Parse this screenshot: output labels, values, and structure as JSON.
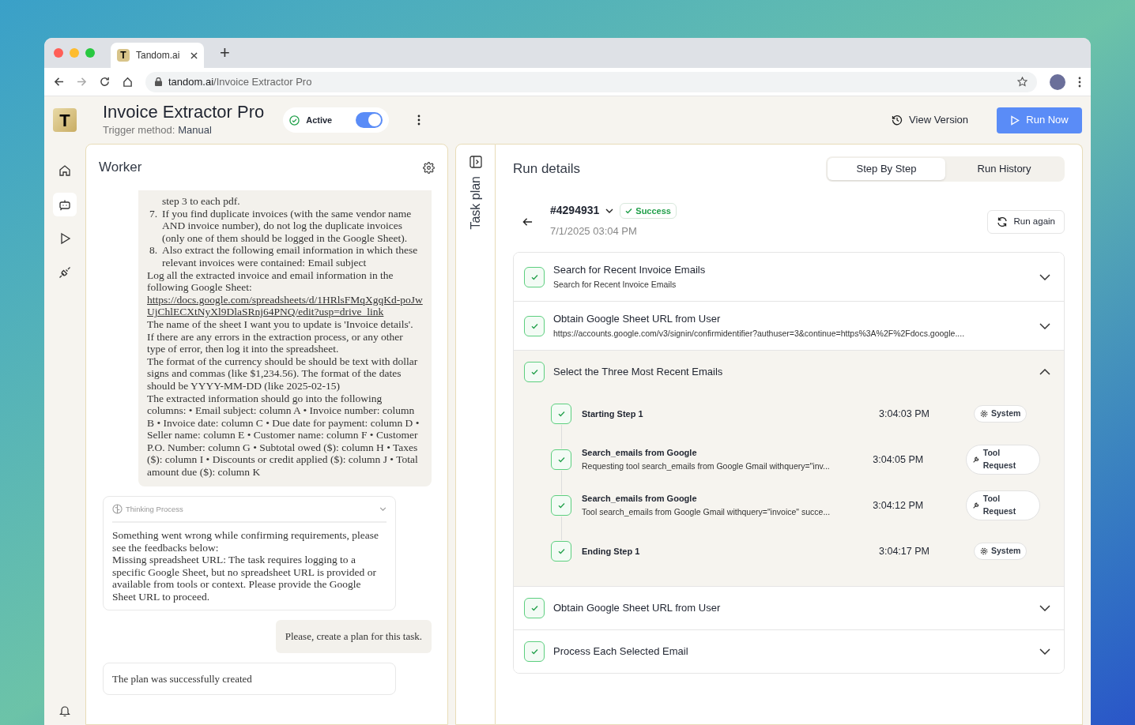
{
  "browser": {
    "tab_title": "Tandom.ai",
    "tab_logo": "T",
    "new_tab": "+",
    "url_host": "tandom.ai",
    "url_path": "/Invoice Extractor Pro"
  },
  "header": {
    "logo": "T",
    "title": "Invoice Extractor Pro",
    "trigger_label": "Trigger method:",
    "trigger_value": "Manual",
    "status": {
      "label": "Active",
      "on": true
    },
    "view_version": "View Version",
    "run_now": "Run Now"
  },
  "sidebar": {
    "items": [
      {
        "selected": false
      },
      {
        "selected": true
      },
      {
        "selected": false
      },
      {
        "selected": false
      }
    ]
  },
  "worker": {
    "title": "Worker",
    "instructions": [
      {
        "kind": "item",
        "text": "step 3 to each pdf."
      },
      {
        "kind": "item",
        "marker": "7.",
        "text": "If you find duplicate invoices (with the same vendor name AND invoice number), do not log the duplicate invoices (only one of them should be logged in the Google Sheet)."
      },
      {
        "kind": "item",
        "marker": "8.",
        "text": "Also extract the following email information in which these relevant invoices were contained: Email subject"
      },
      {
        "kind": "paragraph",
        "text": "Log all the extracted invoice and email information in the following Google Sheet:",
        "link": "https://docs.google.com/spreadsheets/d/1HRlsFMqXgqKd-poJwUjChlECXtNyXl9DlaSRnj64PNQ/edit?usp=drive_link"
      },
      {
        "kind": "paragraph",
        "text": "The name of the sheet I want you to update is 'Invoice details'."
      },
      {
        "kind": "paragraph",
        "text": "If there are any errors in the extraction process, or any other type of error, then log it into the spreadsheet."
      },
      {
        "kind": "paragraph",
        "text": "The format of the currency should be should be text with dollar signs and commas (like $1,234.56). The format of the dates should be YYYY-MM-DD (like 2025-02-15)"
      },
      {
        "kind": "paragraph",
        "text": "The extracted information should go into the following columns: • Email subject: column A • Invoice number: column B • Invoice date: column C • Due date for payment: column D • Seller name: column E • Customer name: column F • Customer P.O. Number: column G • Subtotal owed ($): column H • Taxes ($): column I • Discounts or credit applied ($): column J • Total amount due ($): column K"
      }
    ],
    "messages": [
      {
        "kind": "thinking",
        "label": "Thinking Process",
        "text": "Something went wrong while confirming requirements, please see the feedbacks below:\nMissing spreadsheet URL: The task requires logging to a specific Google Sheet, but no spreadsheet URL is provided or available from tools or context. Please provide the Google Sheet URL to proceed."
      },
      {
        "kind": "user",
        "text": "Please, create a plan for this task."
      },
      {
        "kind": "agent",
        "text": "The plan was successfully created"
      }
    ]
  },
  "task_plan": {
    "label": "Task plan"
  },
  "run_details": {
    "title": "Run details",
    "tabs": [
      {
        "label": "Step By Step",
        "selected": true
      },
      {
        "label": "Run History",
        "selected": false
      }
    ],
    "run": {
      "id": "#4294931",
      "status": "Success",
      "date": "7/1/2025 03:04 PM",
      "run_again": "Run again"
    },
    "steps": [
      {
        "title": "Search for Recent Invoice Emails",
        "subtitle": "Search for Recent Invoice Emails",
        "expanded": false
      },
      {
        "title": "Obtain Google Sheet URL from User",
        "subtitle": "https://accounts.google.com/v3/signin/confirmidentifier?authuser=3&continue=https%3A%2F%2Fdocs.google....",
        "expanded": false
      },
      {
        "title": "Select the Three Most Recent Emails",
        "expanded": true,
        "events": [
          {
            "title": "Starting Step 1",
            "time": "3:04:03 PM",
            "tag": {
              "kind": "system",
              "label": "System"
            }
          },
          {
            "title": "Search_emails from Google",
            "detail": "Requesting tool search_emails from Google Gmail withquery=\"inv...",
            "time": "3:04:05 PM",
            "tag": {
              "kind": "tool",
              "label": "Tool Request"
            }
          },
          {
            "title": "Search_emails from Google",
            "detail": "Tool search_emails from Google Gmail withquery=\"invoice\" succe...",
            "time": "3:04:12 PM",
            "tag": {
              "kind": "tool",
              "label": "Tool Request"
            }
          },
          {
            "title": "Ending Step 1",
            "time": "3:04:17 PM",
            "tag": {
              "kind": "system",
              "label": "System"
            }
          }
        ]
      },
      {
        "title": "Obtain Google Sheet URL from User",
        "expanded": false
      },
      {
        "title": "Process Each Selected Email",
        "expanded": false
      }
    ]
  }
}
